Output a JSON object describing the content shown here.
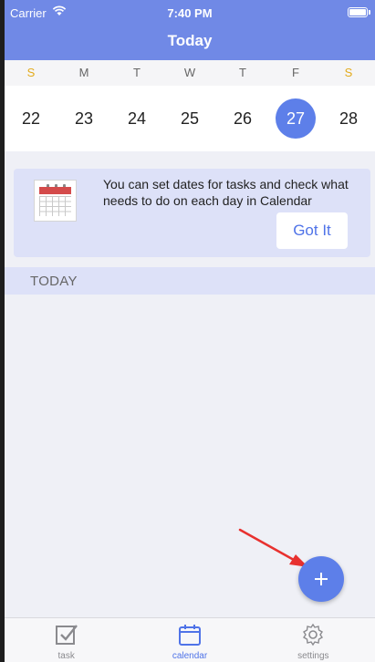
{
  "status_bar": {
    "carrier": "Carrier",
    "time": "7:40 PM"
  },
  "nav": {
    "title": "Today"
  },
  "week": {
    "days": [
      {
        "label": "S",
        "weekend": true
      },
      {
        "label": "M",
        "weekend": false
      },
      {
        "label": "T",
        "weekend": false
      },
      {
        "label": "W",
        "weekend": false
      },
      {
        "label": "T",
        "weekend": false
      },
      {
        "label": "F",
        "weekend": false
      },
      {
        "label": "S",
        "weekend": true
      }
    ],
    "dates": [
      "22",
      "23",
      "24",
      "25",
      "26",
      "27",
      "28"
    ],
    "selected_index": 5
  },
  "tip": {
    "text": "You can set dates for tasks and check what needs to do on each day in Calendar",
    "button_label": "Got It",
    "icon": "calendar-image-icon"
  },
  "section": {
    "title": "TODAY"
  },
  "fab": {
    "icon": "plus-icon"
  },
  "tabs": [
    {
      "label": "task",
      "icon": "checkbox-icon",
      "active": false
    },
    {
      "label": "calendar",
      "icon": "calendar-icon",
      "active": true
    },
    {
      "label": "settings",
      "icon": "gear-icon",
      "active": false
    }
  ],
  "colors": {
    "header": "#7089e6",
    "accent": "#5d7fe9",
    "weekend": "#e3ab1c",
    "tip_background": "#dde1f8",
    "annotation_arrow": "#e8312f"
  }
}
